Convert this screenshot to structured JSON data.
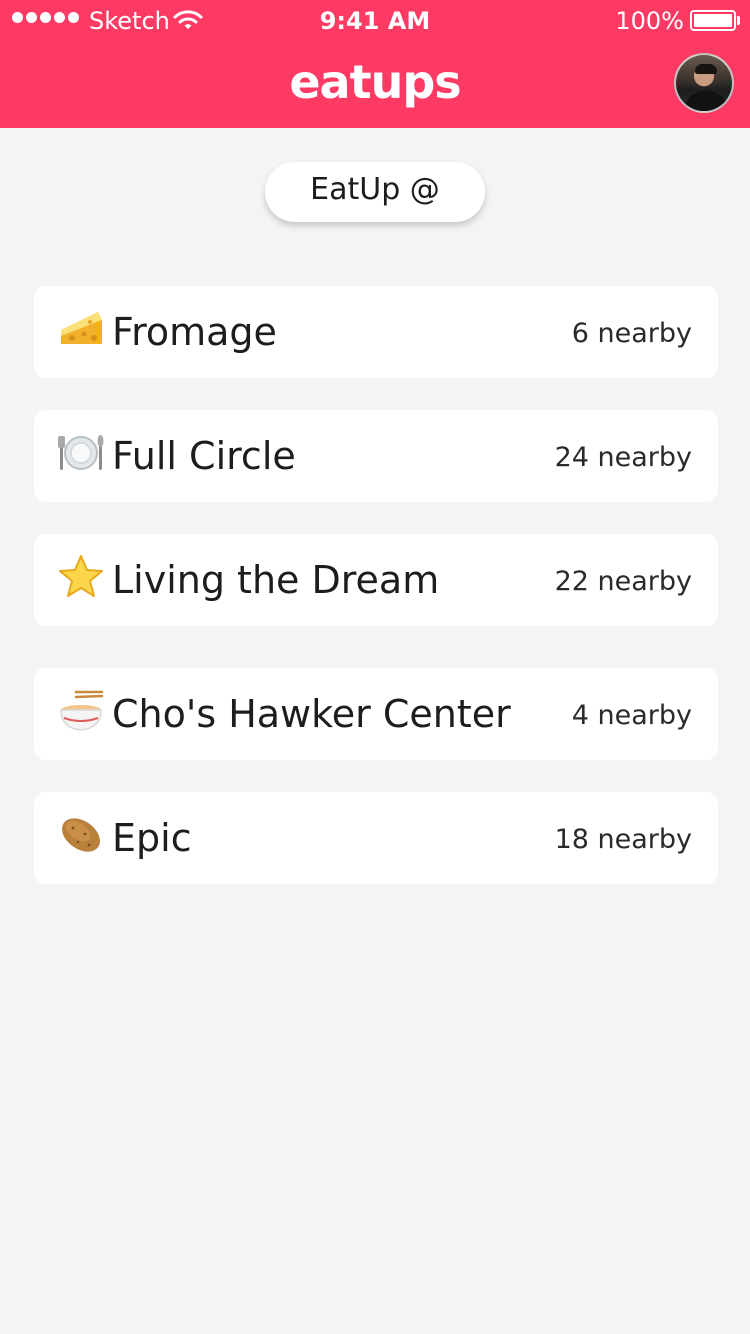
{
  "status_bar": {
    "carrier": "Sketch",
    "time": "9:41 AM",
    "battery": "100%",
    "signal_icon": "signal-dots-icon",
    "wifi_icon": "wifi-icon",
    "battery_icon": "battery-icon"
  },
  "header": {
    "title": "eatups",
    "avatar_icon": "user-avatar",
    "background_color": "#fc3a64"
  },
  "location_pill": {
    "label": "EatUp @"
  },
  "venues": [
    {
      "emoji": "cheese-icon",
      "name": "Fromage",
      "count": "6 nearby"
    },
    {
      "emoji": "plate-cutlery-icon",
      "name": "Full Circle",
      "count": "24 nearby"
    },
    {
      "emoji": "star-icon",
      "name": "Living the Dream",
      "count": "22 nearby"
    },
    {
      "emoji": "noodle-bowl-icon",
      "name": "Cho's Hawker Center",
      "count": "4 nearby"
    },
    {
      "emoji": "potato-icon",
      "name": "Epic",
      "count": "18 nearby"
    }
  ]
}
